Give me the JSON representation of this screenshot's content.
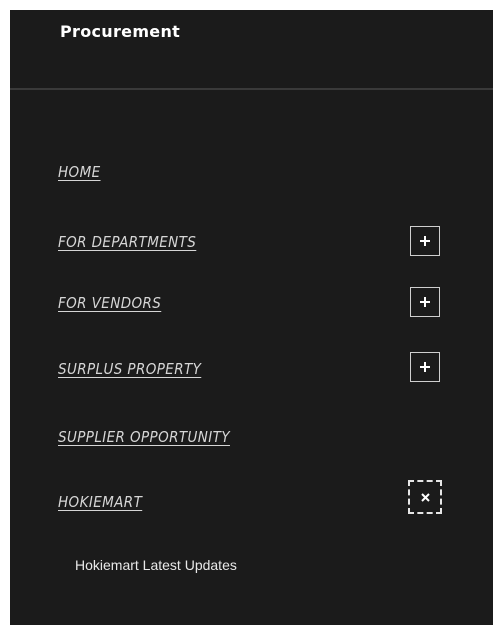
{
  "header": {
    "title": "Procurement"
  },
  "nav": {
    "home": {
      "label": "HOME"
    },
    "departments": {
      "label": "FOR DEPARTMENTS",
      "toggle_icon": "plus-icon"
    },
    "vendors": {
      "label": "FOR VENDORS",
      "toggle_icon": "plus-icon"
    },
    "surplus": {
      "label": "SURPLUS PROPERTY",
      "toggle_icon": "plus-icon"
    },
    "supplier": {
      "label": "SUPPLIER OPPORTUNITY"
    },
    "hokiemart": {
      "label": "HOKIEMART",
      "toggle_icon": "close-icon",
      "expanded": true,
      "children": [
        {
          "label": "Hokiemart Latest Updates"
        }
      ]
    }
  },
  "colors": {
    "panel_bg": "#1b1b1b",
    "text": "#d6d6d6",
    "border": "#cfcfcf"
  }
}
